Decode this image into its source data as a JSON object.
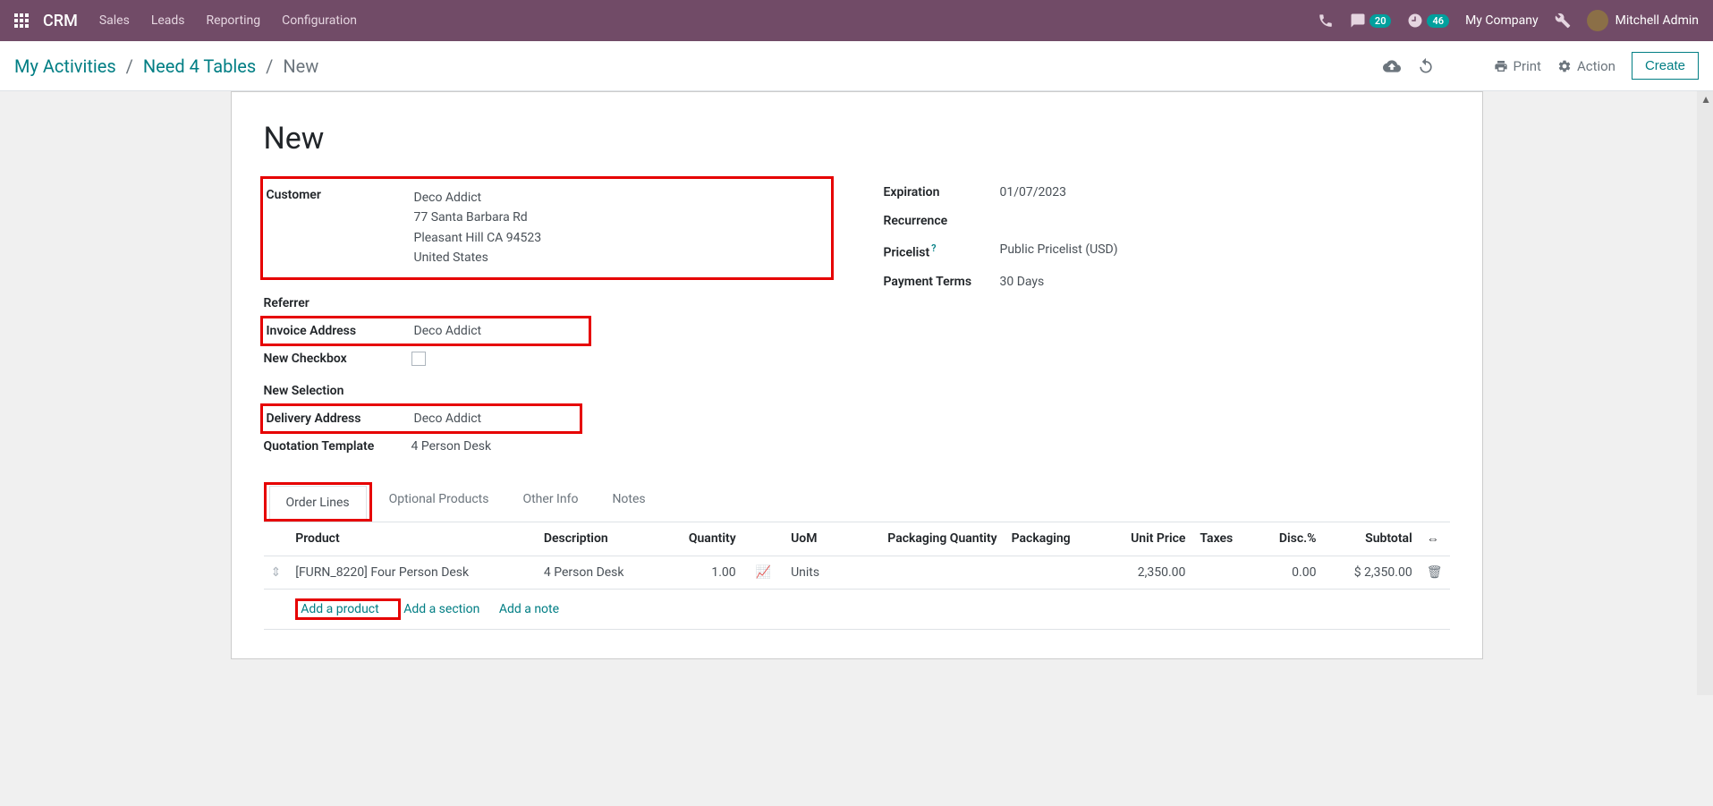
{
  "nav": {
    "brand": "CRM",
    "links": [
      "Sales",
      "Leads",
      "Reporting",
      "Configuration"
    ],
    "messages_badge": "20",
    "activities_badge": "46",
    "company": "My Company",
    "user": "Mitchell Admin"
  },
  "breadcrumb": {
    "items": [
      "My Activities",
      "Need 4 Tables"
    ],
    "current": "New"
  },
  "cp": {
    "print": "Print",
    "action": "Action",
    "create": "Create"
  },
  "form": {
    "title": "New",
    "left": {
      "customer_label": "Customer",
      "customer_name": "Deco Addict",
      "customer_addr1": "77 Santa Barbara Rd",
      "customer_addr2": "Pleasant Hill CA 94523",
      "customer_addr3": "United States",
      "referrer_label": "Referrer",
      "invoice_label": "Invoice Address",
      "invoice_value": "Deco Addict",
      "newcheck_label": "New Checkbox",
      "newsel_label": "New Selection",
      "delivery_label": "Delivery Address",
      "delivery_value": "Deco Addict",
      "qtemplate_label": "Quotation Template",
      "qtemplate_value": "4 Person Desk"
    },
    "right": {
      "expiration_label": "Expiration",
      "expiration_value": "01/07/2023",
      "recurrence_label": "Recurrence",
      "pricelist_label": "Pricelist",
      "pricelist_value": "Public Pricelist (USD)",
      "payment_label": "Payment Terms",
      "payment_value": "30 Days"
    }
  },
  "tabs": [
    "Order Lines",
    "Optional Products",
    "Other Info",
    "Notes"
  ],
  "table": {
    "headers": {
      "product": "Product",
      "description": "Description",
      "quantity": "Quantity",
      "uom": "UoM",
      "pkg_qty": "Packaging Quantity",
      "pkg": "Packaging",
      "unit_price": "Unit Price",
      "taxes": "Taxes",
      "disc": "Disc.%",
      "subtotal": "Subtotal"
    },
    "rows": [
      {
        "product": "[FURN_8220] Four Person Desk",
        "description": "4 Person Desk",
        "quantity": "1.00",
        "uom": "Units",
        "unit_price": "2,350.00",
        "disc": "0.00",
        "subtotal": "$ 2,350.00"
      }
    ],
    "add_product": "Add a product",
    "add_section": "Add a section",
    "add_note": "Add a note"
  }
}
